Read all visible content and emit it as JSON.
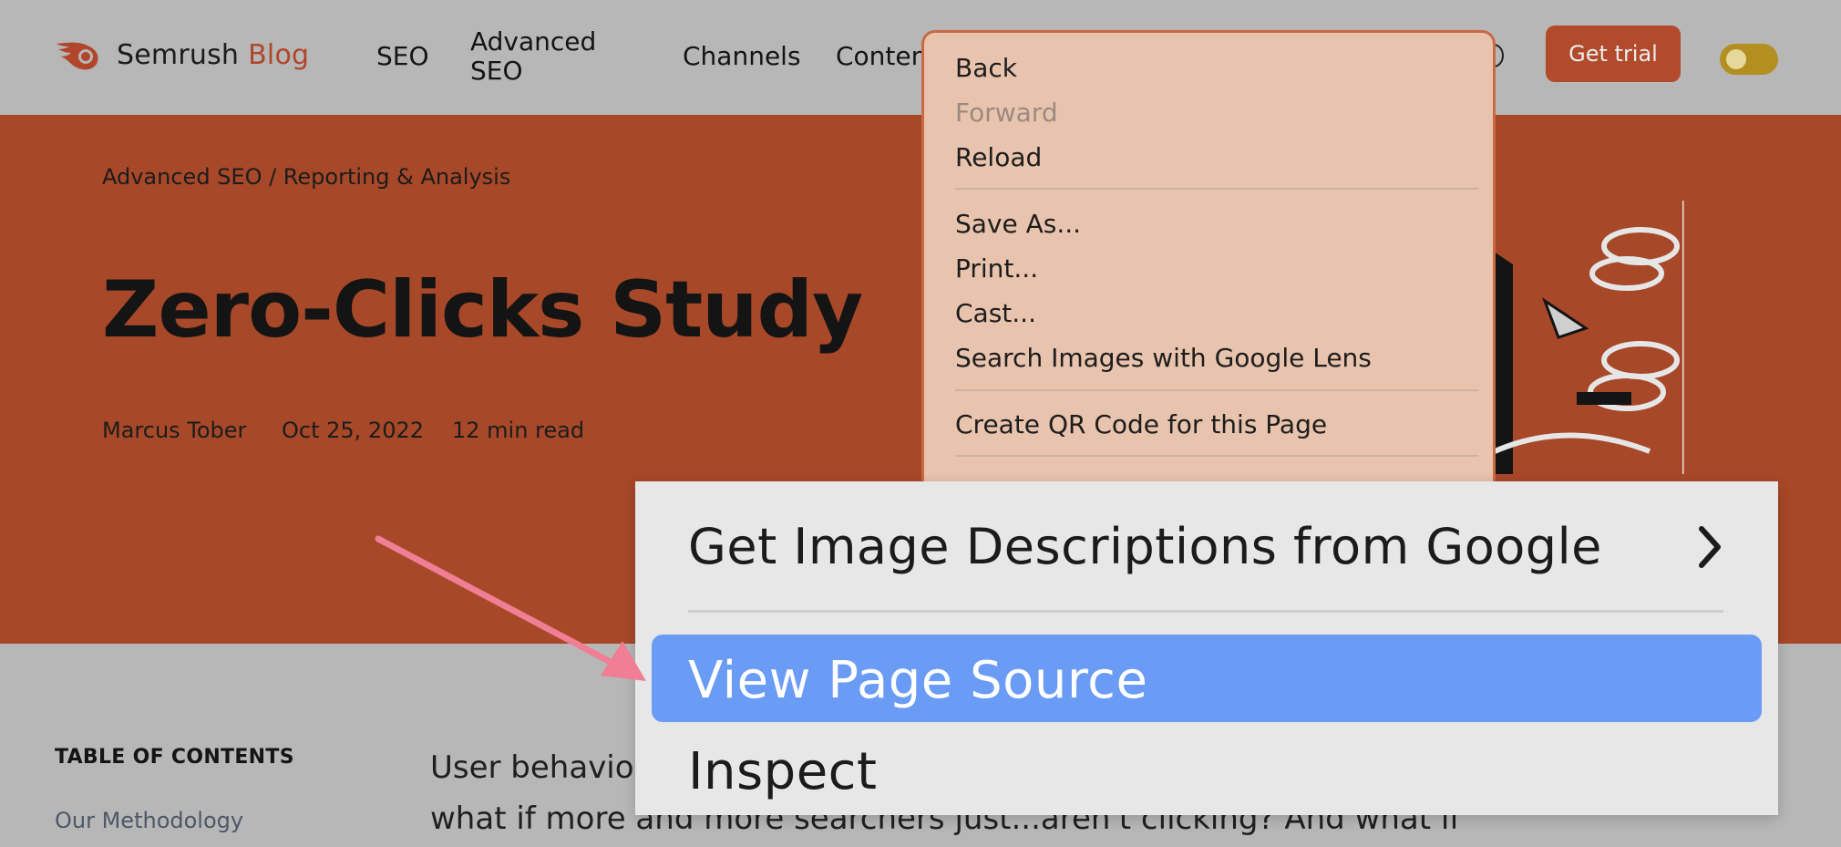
{
  "header": {
    "brand": "Semrush",
    "brand_suffix": "Blog",
    "nav": [
      {
        "label": "SEO"
      },
      {
        "label": "Advanced\nSEO"
      },
      {
        "label": "Channels"
      },
      {
        "label": "Conten"
      }
    ],
    "get_trial_label": "Get trial"
  },
  "hero": {
    "breadcrumb": "Advanced SEO /  Reporting & Analysis",
    "title": "Zero-Clicks Study",
    "author": "Marcus Tober",
    "date": "Oct 25, 2022",
    "read_time": "12 min read"
  },
  "toc": {
    "title": "TABLE OF CONTENTS",
    "items": [
      "Our Methodology"
    ]
  },
  "article": {
    "line1": "User behavio",
    "line2": "what if more and more searchers just...aren't clicking? And what if"
  },
  "context_menu": {
    "items": [
      {
        "label": "Back",
        "enabled": true
      },
      {
        "label": "Forward",
        "enabled": false
      },
      {
        "label": "Reload",
        "enabled": true
      },
      {
        "label": "Save As...",
        "enabled": true
      },
      {
        "label": "Print...",
        "enabled": true
      },
      {
        "label": "Cast...",
        "enabled": true
      },
      {
        "label": "Search Images with Google Lens",
        "enabled": true
      },
      {
        "label": "Create QR Code for this Page",
        "enabled": true
      }
    ]
  },
  "zoomed_menu": {
    "item1": "Get Image Descriptions from Google",
    "item2": "View Page Source",
    "item3": "Inspect",
    "highlighted": "View Page Source"
  },
  "colors": {
    "brand": "#b0462a",
    "hero_bg": "#a74828",
    "highlight": "#6a9bf5",
    "arrow": "#f07e94"
  }
}
